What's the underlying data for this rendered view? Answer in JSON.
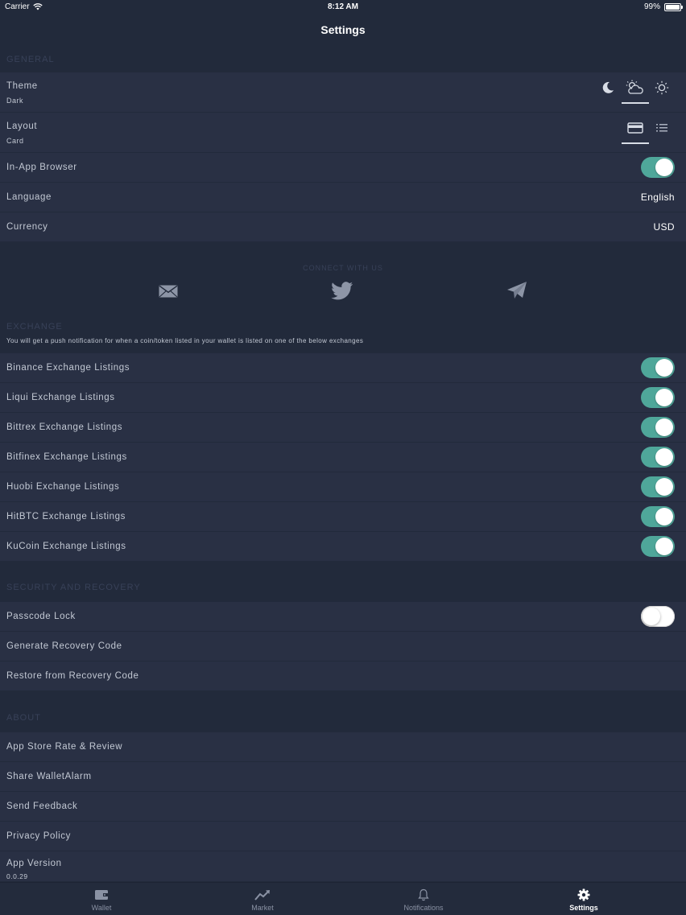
{
  "status_bar": {
    "carrier": "Carrier",
    "time": "8:12 AM",
    "battery": "99%",
    "battery_level": 0.99
  },
  "nav": {
    "title": "Settings"
  },
  "general": {
    "header": "GENERAL",
    "theme": {
      "label": "Theme",
      "value": "Dark",
      "options": [
        "moon-icon",
        "cloud-sun-icon",
        "sun-icon"
      ],
      "selected": "cloud-sun-icon"
    },
    "layout": {
      "label": "Layout",
      "value": "Card",
      "options": [
        "card-icon",
        "list-icon"
      ],
      "selected": "card-icon"
    },
    "in_app_browser": {
      "label": "In-App Browser",
      "on": true
    },
    "language": {
      "label": "Language",
      "value": "English"
    },
    "currency": {
      "label": "Currency",
      "value": "USD"
    }
  },
  "connect": {
    "title": "CONNECT WITH US",
    "items": [
      "mail-icon",
      "twitter-icon",
      "telegram-icon"
    ]
  },
  "exchange": {
    "header": "EXCHANGE",
    "description": "You will get a push notification for when a coin/token listed in your wallet is listed on one of the below exchanges",
    "items": [
      {
        "label": "Binance Exchange Listings",
        "on": true
      },
      {
        "label": "Liqui Exchange Listings",
        "on": true
      },
      {
        "label": "Bittrex Exchange Listings",
        "on": true
      },
      {
        "label": "Bitfinex Exchange Listings",
        "on": true
      },
      {
        "label": "Huobi Exchange Listings",
        "on": true
      },
      {
        "label": "HitBTC Exchange Listings",
        "on": true
      },
      {
        "label": "KuCoin Exchange Listings",
        "on": true
      }
    ]
  },
  "security": {
    "header": "SECURITY AND RECOVERY",
    "passcode_lock": {
      "label": "Passcode Lock",
      "on": false
    },
    "generate": {
      "label": "Generate Recovery Code"
    },
    "restore": {
      "label": "Restore from Recovery Code"
    }
  },
  "about": {
    "header": "ABOUT",
    "rate": "App Store Rate & Review",
    "share": "Share WalletAlarm",
    "feedback": "Send Feedback",
    "privacy": "Privacy Policy",
    "version_label": "App Version",
    "version": "0.0.29"
  },
  "tabbar": {
    "items": [
      {
        "label": "Wallet",
        "icon": "wallet-icon"
      },
      {
        "label": "Market",
        "icon": "chart-line-icon"
      },
      {
        "label": "Notifications",
        "icon": "bell-icon"
      },
      {
        "label": "Settings",
        "icon": "gear-icon"
      }
    ],
    "active": "Settings"
  },
  "colors": {
    "background": "#222a3b",
    "row": "#293044",
    "accent": "#4fa79a",
    "section_header": "#384158",
    "text": "#c3c9d4"
  }
}
